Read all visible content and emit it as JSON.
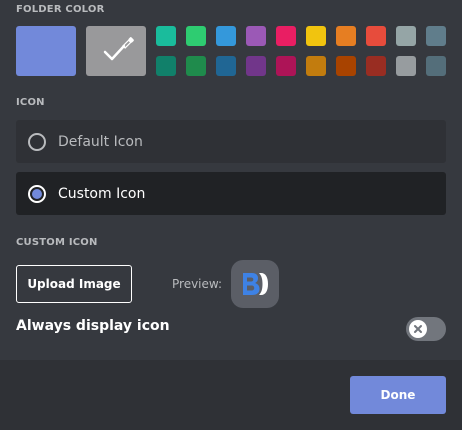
{
  "folder_color": {
    "title": "FOLDER COLOR",
    "default_color": "#7289da",
    "custom_color": "#99999b",
    "custom_icon": "eyedropper-check-icon",
    "swatches_top": [
      "#1abc9c",
      "#2ecc71",
      "#3498db",
      "#9b59b6",
      "#e91e63",
      "#f1c40f",
      "#e67e22",
      "#e74c3c",
      "#95a5a6",
      "#607d8b"
    ],
    "swatches_bottom": [
      "#11806a",
      "#1f8b4c",
      "#206694",
      "#71368a",
      "#ad1457",
      "#c27c0e",
      "#a84300",
      "#992d22",
      "#979c9f",
      "#546e7a"
    ]
  },
  "icon": {
    "title": "ICON",
    "options": [
      {
        "label": "Default Icon",
        "selected": false
      },
      {
        "label": "Custom Icon",
        "selected": true
      }
    ],
    "accent": "#7289da"
  },
  "custom_icon": {
    "title": "CUSTOM ICON",
    "upload_label": "Upload Image",
    "preview_label": "Preview:",
    "preview_icon": "bd-logo-icon"
  },
  "always_display": {
    "label": "Always display icon",
    "enabled": false,
    "toggle_icon": "x-icon"
  },
  "footer": {
    "done_label": "Done"
  }
}
